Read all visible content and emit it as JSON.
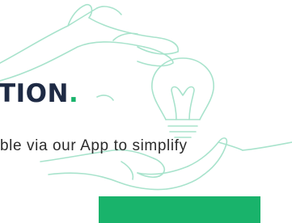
{
  "hero": {
    "headline": "TION",
    "headline_dot": ".",
    "subtext": "ble via our App to simplify"
  },
  "cta": {
    "label": ""
  },
  "colors": {
    "accent": "#19b36b",
    "headline": "#1e2a44",
    "line_art": "#a8e3cc"
  },
  "icons": {
    "illustration": "hand-holding-lightbulb-icon"
  }
}
